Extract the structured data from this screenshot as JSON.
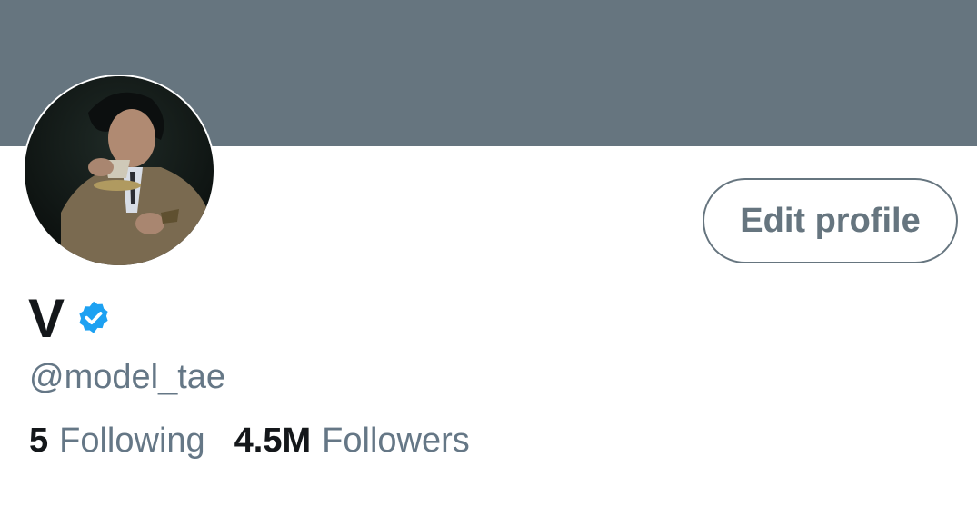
{
  "colors": {
    "banner": "#66757f",
    "accent_verified": "#1da1f2",
    "text_primary": "#14171a",
    "text_secondary": "#657786"
  },
  "profile": {
    "display_name": "V",
    "verified_icon": "verified-badge-icon",
    "handle": "@model_tae",
    "edit_button_label": "Edit profile"
  },
  "stats": {
    "following_count": "5",
    "following_label": "Following",
    "followers_count": "4.5M",
    "followers_label": "Followers"
  }
}
